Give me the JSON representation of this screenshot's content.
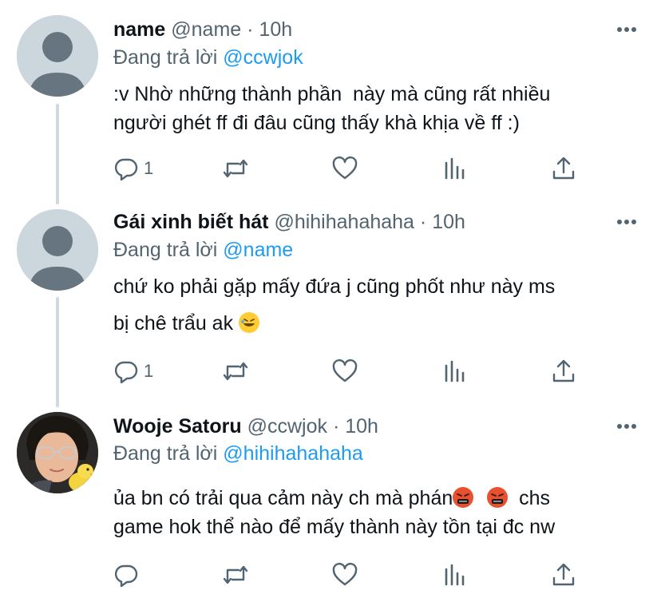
{
  "reply_prefix": "Đang trả lời",
  "tweets": [
    {
      "display_name": "name",
      "handle": "@name",
      "separator": "·",
      "time": "10h",
      "replying_to": "@ccwjok",
      "text_lines": [
        ":v Nhờ những thành phần  này mà cũng rất nhiều",
        "người ghét ff đi đâu cũng thấy khà khịa về ff :)"
      ],
      "reply_count": "1",
      "avatar": "default-avatar-icon"
    },
    {
      "display_name": "Gái xinh biết hát",
      "handle": "@hihihahahaha",
      "separator": "·",
      "time": "10h",
      "replying_to": "@name",
      "text_lines": [
        "chứ ko phải gặp mấy đứa j cũng phốt như này ms",
        "bị chê trẩu ak"
      ],
      "reply_count": "1",
      "avatar": "default-avatar-icon"
    },
    {
      "display_name": "Wooje Satoru",
      "handle": "@ccwjok",
      "separator": "·",
      "time": "10h",
      "replying_to": "@hihihahahaha",
      "text_lines": [
        "ủa bn có trải qua cảm này ch mà phán",
        "  chs",
        "game hok thể nào để mấy thành này tồn tại đc nw"
      ],
      "reply_count": "",
      "avatar": "photo-avatar"
    }
  ],
  "colors": {
    "accent": "#1d9bf0",
    "secondary_text": "#536471",
    "thread_line": "#cfd9de",
    "icon": "#536471"
  }
}
